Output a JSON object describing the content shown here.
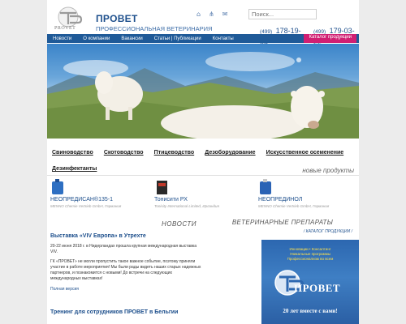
{
  "header": {
    "logo_text": "PROVET",
    "brand_name": "ПРОВЕТ",
    "brand_subtitle": "ПРОФЕССИОНАЛЬНАЯ ВЕТЕРИНАРИЯ",
    "search_placeholder": "Поиск...",
    "phones": [
      {
        "code": "(499)",
        "number": "178-19-03"
      },
      {
        "code": "(499)",
        "number": "179-03-55"
      }
    ],
    "icons": [
      "home-icon",
      "sitemap-icon",
      "mail-icon"
    ]
  },
  "nav": {
    "items": [
      "Новости",
      "О компании",
      "Вакансии",
      "Статьи | Публикации",
      "Контакты"
    ],
    "catalog": "Каталог продукции"
  },
  "categories": [
    "Свиноводство",
    "Скотоводство",
    "Птицеводство",
    "Дезоборудование",
    "Искусственное осеменение",
    "Дезинфектанты"
  ],
  "new_products": {
    "title": "новые продукты",
    "items": [
      {
        "name": "НЕОПРЕДИСАН®135-1",
        "maker": "MENNO Chemie Vertrieb GmbH, Германия"
      },
      {
        "name": "Тонисити РХ",
        "maker": "Tonisity International Limited, Ирландия"
      },
      {
        "name": "НЕОПРЕДИНОЛ",
        "maker": "MENNO Chemie Vertrieb GmbH, Германия"
      }
    ]
  },
  "news": {
    "title": "НОВОСТИ",
    "item1": {
      "title": "Выставка «VIV Европа» в Утрехте",
      "date": "20-22 июня 2018 г. в Нидерландах прошла крупная международная выставка VIV.",
      "body": "ГК «ПРОВЕТ» не могли пропустить такое важное событие, поэтому приняли участие в работе мероприятия! Мы были рады видеть наших старых надежных партнеров, и познакомится с новыми! До встречи на следующих международных выставках!",
      "more": "Полная версия"
    },
    "item2_title": "Тренинг для сотрудников ПРОВЕТ в Бельгии"
  },
  "vet": {
    "title": "ВЕТЕРИНАРНЫЕ ПРЕПАРАТЫ",
    "link": "/ КАТАЛОГ ПРОДУКЦИИ /",
    "banner_lines": [
      "Инновации • Консалтинг",
      "Уникальные программы",
      "Профессионализм во всем"
    ],
    "banner_name": "ПРОВЕТ",
    "banner_slogan": "20 лет вместе с вами!"
  },
  "colors": {
    "brand_blue": "#1d4f8c",
    "nav_blue": "#1f5a98",
    "catalog_pink": "#d01f73"
  }
}
